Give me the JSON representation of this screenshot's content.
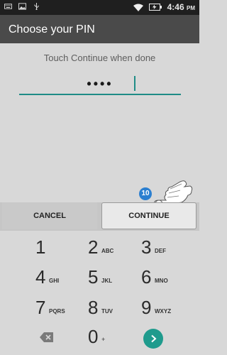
{
  "status_bar": {
    "icons": [
      "keyboard-icon",
      "image-icon",
      "usb-icon"
    ],
    "status_icons": [
      "wifi-icon",
      "battery-charging-icon"
    ],
    "time": "4:46",
    "ampm": "PM"
  },
  "app_bar": {
    "title": "Choose your PIN"
  },
  "instruction": "Touch Continue when done",
  "pin": {
    "value": "••••",
    "field_color": "#1f8c86"
  },
  "overlay": {
    "step": "10",
    "hand_icon": "hand-pointer-icon"
  },
  "buttons": {
    "cancel": "CANCEL",
    "continue": "CONTINUE"
  },
  "keypad": {
    "rows": [
      [
        {
          "digit": "1",
          "letters": ""
        },
        {
          "digit": "2",
          "letters": "ABC"
        },
        {
          "digit": "3",
          "letters": "DEF"
        }
      ],
      [
        {
          "digit": "4",
          "letters": "GHI"
        },
        {
          "digit": "5",
          "letters": "JKL"
        },
        {
          "digit": "6",
          "letters": "MNO"
        }
      ],
      [
        {
          "digit": "7",
          "letters": "PQRS"
        },
        {
          "digit": "8",
          "letters": "TUV"
        },
        {
          "digit": "9",
          "letters": "WXYZ"
        }
      ]
    ],
    "zero": "0",
    "zero_sub": "+",
    "backspace_icon": "backspace-icon",
    "go_icon": "chevron-right-icon",
    "accent": "#1f9b8d"
  }
}
